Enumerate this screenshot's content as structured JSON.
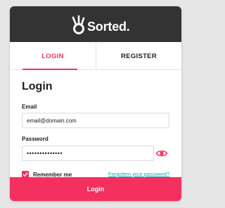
{
  "brand": {
    "name": "Sorted.",
    "accent_color": "#f4305f",
    "header_color": "#333333",
    "link_color": "#1ba3b6"
  },
  "tabs": [
    {
      "label": "LOGIN",
      "active": true
    },
    {
      "label": "REGISTER",
      "active": false
    }
  ],
  "form": {
    "title": "Login",
    "email": {
      "label": "Email",
      "value": "email@domain.com"
    },
    "password": {
      "label": "Password",
      "value": "••••••••••••••"
    },
    "remember": {
      "label": "Remember me",
      "checked": true
    },
    "forgot_link": "Forgotten your password?",
    "submit_label": "Login"
  }
}
